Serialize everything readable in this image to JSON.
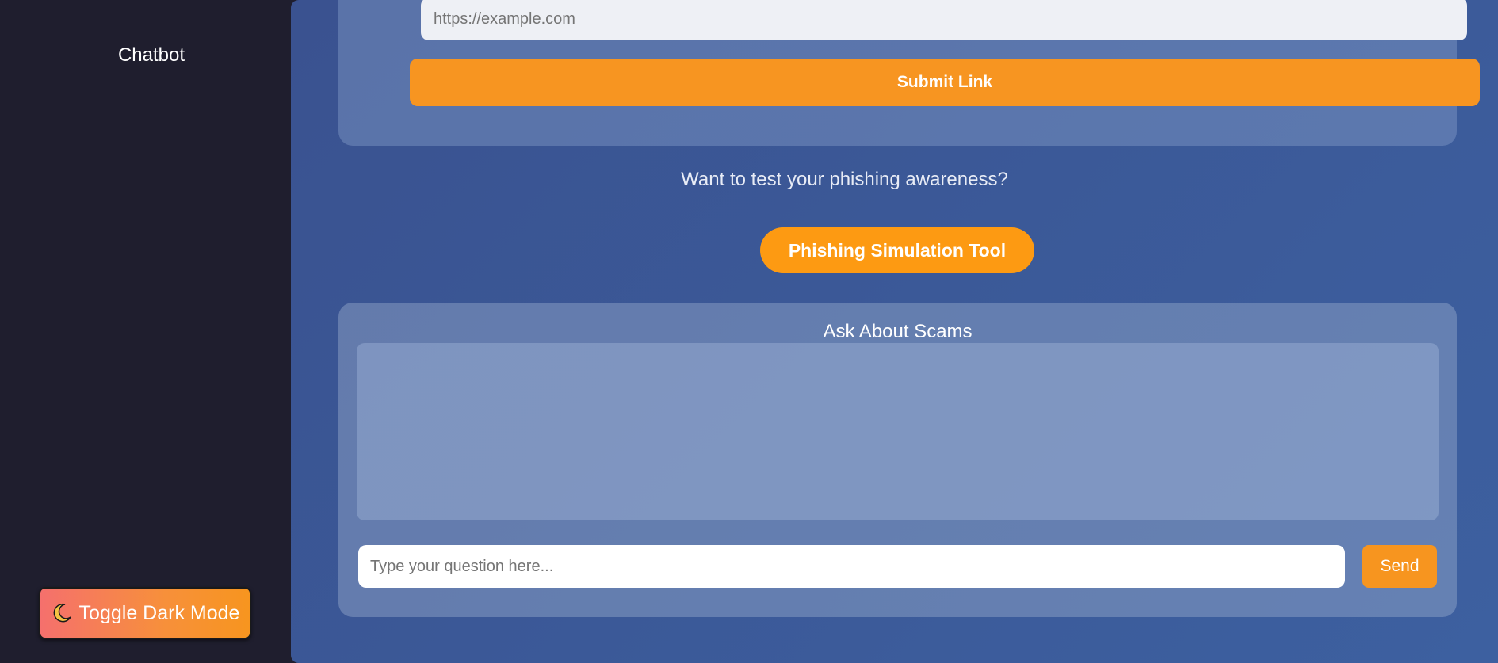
{
  "sidebar": {
    "link_label": "Chatbot",
    "toggle": {
      "icon": "moon-icon",
      "label": "Toggle Dark Mode"
    }
  },
  "link_checker": {
    "url_placeholder": "https://example.com",
    "submit_label": "Submit Link"
  },
  "phishing": {
    "prompt": "Want to test your phishing awareness?",
    "button_label": "Phishing Simulation Tool"
  },
  "chat": {
    "title": "Ask About Scams",
    "input_placeholder": "Type your question here...",
    "send_label": "Send"
  },
  "colors": {
    "sidebar_bg": "#1f1e2e",
    "accent_orange": "#f7951f",
    "main_bg": "#3b5998"
  }
}
